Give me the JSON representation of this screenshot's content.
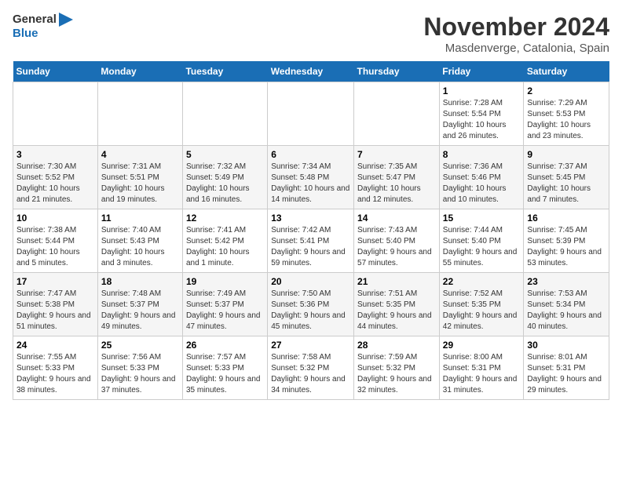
{
  "logo": {
    "text_general": "General",
    "text_blue": "Blue"
  },
  "header": {
    "month": "November 2024",
    "location": "Masdenverge, Catalonia, Spain"
  },
  "weekdays": [
    "Sunday",
    "Monday",
    "Tuesday",
    "Wednesday",
    "Thursday",
    "Friday",
    "Saturday"
  ],
  "weeks": [
    [
      {
        "day": "",
        "info": ""
      },
      {
        "day": "",
        "info": ""
      },
      {
        "day": "",
        "info": ""
      },
      {
        "day": "",
        "info": ""
      },
      {
        "day": "",
        "info": ""
      },
      {
        "day": "1",
        "info": "Sunrise: 7:28 AM\nSunset: 5:54 PM\nDaylight: 10 hours and 26 minutes."
      },
      {
        "day": "2",
        "info": "Sunrise: 7:29 AM\nSunset: 5:53 PM\nDaylight: 10 hours and 23 minutes."
      }
    ],
    [
      {
        "day": "3",
        "info": "Sunrise: 7:30 AM\nSunset: 5:52 PM\nDaylight: 10 hours and 21 minutes."
      },
      {
        "day": "4",
        "info": "Sunrise: 7:31 AM\nSunset: 5:51 PM\nDaylight: 10 hours and 19 minutes."
      },
      {
        "day": "5",
        "info": "Sunrise: 7:32 AM\nSunset: 5:49 PM\nDaylight: 10 hours and 16 minutes."
      },
      {
        "day": "6",
        "info": "Sunrise: 7:34 AM\nSunset: 5:48 PM\nDaylight: 10 hours and 14 minutes."
      },
      {
        "day": "7",
        "info": "Sunrise: 7:35 AM\nSunset: 5:47 PM\nDaylight: 10 hours and 12 minutes."
      },
      {
        "day": "8",
        "info": "Sunrise: 7:36 AM\nSunset: 5:46 PM\nDaylight: 10 hours and 10 minutes."
      },
      {
        "day": "9",
        "info": "Sunrise: 7:37 AM\nSunset: 5:45 PM\nDaylight: 10 hours and 7 minutes."
      }
    ],
    [
      {
        "day": "10",
        "info": "Sunrise: 7:38 AM\nSunset: 5:44 PM\nDaylight: 10 hours and 5 minutes."
      },
      {
        "day": "11",
        "info": "Sunrise: 7:40 AM\nSunset: 5:43 PM\nDaylight: 10 hours and 3 minutes."
      },
      {
        "day": "12",
        "info": "Sunrise: 7:41 AM\nSunset: 5:42 PM\nDaylight: 10 hours and 1 minute."
      },
      {
        "day": "13",
        "info": "Sunrise: 7:42 AM\nSunset: 5:41 PM\nDaylight: 9 hours and 59 minutes."
      },
      {
        "day": "14",
        "info": "Sunrise: 7:43 AM\nSunset: 5:40 PM\nDaylight: 9 hours and 57 minutes."
      },
      {
        "day": "15",
        "info": "Sunrise: 7:44 AM\nSunset: 5:40 PM\nDaylight: 9 hours and 55 minutes."
      },
      {
        "day": "16",
        "info": "Sunrise: 7:45 AM\nSunset: 5:39 PM\nDaylight: 9 hours and 53 minutes."
      }
    ],
    [
      {
        "day": "17",
        "info": "Sunrise: 7:47 AM\nSunset: 5:38 PM\nDaylight: 9 hours and 51 minutes."
      },
      {
        "day": "18",
        "info": "Sunrise: 7:48 AM\nSunset: 5:37 PM\nDaylight: 9 hours and 49 minutes."
      },
      {
        "day": "19",
        "info": "Sunrise: 7:49 AM\nSunset: 5:37 PM\nDaylight: 9 hours and 47 minutes."
      },
      {
        "day": "20",
        "info": "Sunrise: 7:50 AM\nSunset: 5:36 PM\nDaylight: 9 hours and 45 minutes."
      },
      {
        "day": "21",
        "info": "Sunrise: 7:51 AM\nSunset: 5:35 PM\nDaylight: 9 hours and 44 minutes."
      },
      {
        "day": "22",
        "info": "Sunrise: 7:52 AM\nSunset: 5:35 PM\nDaylight: 9 hours and 42 minutes."
      },
      {
        "day": "23",
        "info": "Sunrise: 7:53 AM\nSunset: 5:34 PM\nDaylight: 9 hours and 40 minutes."
      }
    ],
    [
      {
        "day": "24",
        "info": "Sunrise: 7:55 AM\nSunset: 5:33 PM\nDaylight: 9 hours and 38 minutes."
      },
      {
        "day": "25",
        "info": "Sunrise: 7:56 AM\nSunset: 5:33 PM\nDaylight: 9 hours and 37 minutes."
      },
      {
        "day": "26",
        "info": "Sunrise: 7:57 AM\nSunset: 5:33 PM\nDaylight: 9 hours and 35 minutes."
      },
      {
        "day": "27",
        "info": "Sunrise: 7:58 AM\nSunset: 5:32 PM\nDaylight: 9 hours and 34 minutes."
      },
      {
        "day": "28",
        "info": "Sunrise: 7:59 AM\nSunset: 5:32 PM\nDaylight: 9 hours and 32 minutes."
      },
      {
        "day": "29",
        "info": "Sunrise: 8:00 AM\nSunset: 5:31 PM\nDaylight: 9 hours and 31 minutes."
      },
      {
        "day": "30",
        "info": "Sunrise: 8:01 AM\nSunset: 5:31 PM\nDaylight: 9 hours and 29 minutes."
      }
    ]
  ]
}
